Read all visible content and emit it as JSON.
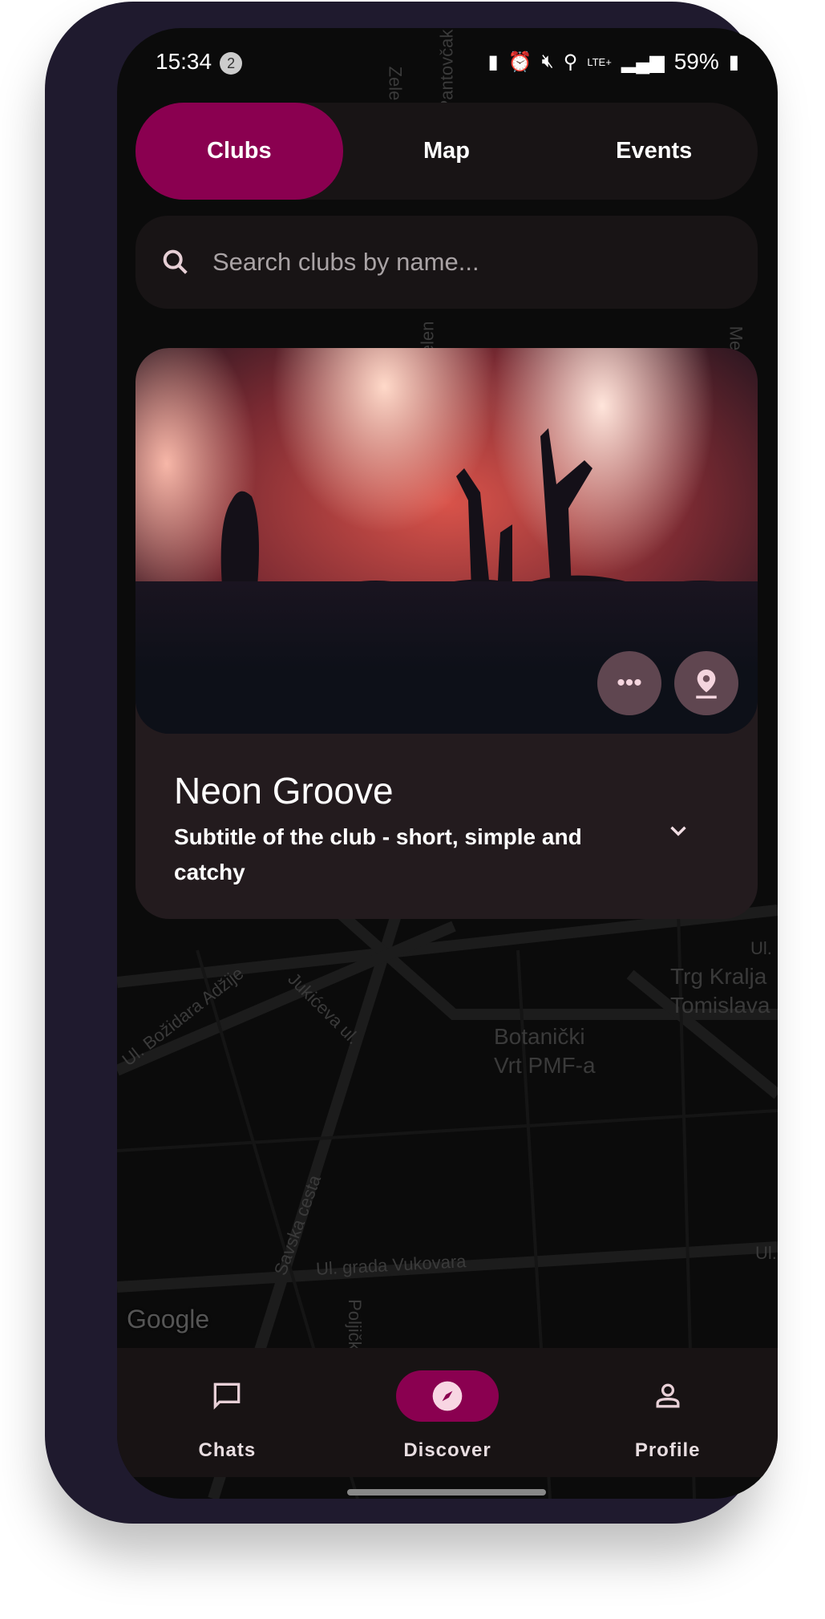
{
  "status_bar": {
    "time": "15:34",
    "notification_count": "2",
    "network": "LTE+",
    "battery": "59%"
  },
  "top_tabs": [
    {
      "label": "Clubs",
      "active": true
    },
    {
      "label": "Map",
      "active": false
    },
    {
      "label": "Events",
      "active": false
    }
  ],
  "search": {
    "placeholder": "Search clubs by name...",
    "value": ""
  },
  "club_card": {
    "title": "Neon Groove",
    "subtitle": "Subtitle of the club - short, simple and catchy"
  },
  "map": {
    "labels": [
      "Pantovčak",
      "Zele",
      "Zelen",
      "Med",
      "Ul. Božidara Adžije",
      "Jukićeva ul.",
      "Botanički Vrt PMF-a",
      "Trg Kralja Tomislava",
      "Ul.",
      "Savska cesta",
      "Ul. grada Vukovara",
      "Poljička",
      "Ul."
    ],
    "attribution": "Google"
  },
  "bottom_nav": [
    {
      "label": "Chats",
      "icon": "chat-bubble-icon",
      "active": false
    },
    {
      "label": "Discover",
      "icon": "compass-icon",
      "active": true
    },
    {
      "label": "Profile",
      "icon": "person-icon",
      "active": false
    }
  ],
  "colors": {
    "accent": "#8a0050",
    "surface": "#181415",
    "card": "#231b1e",
    "frame": "#1f1a2e"
  }
}
